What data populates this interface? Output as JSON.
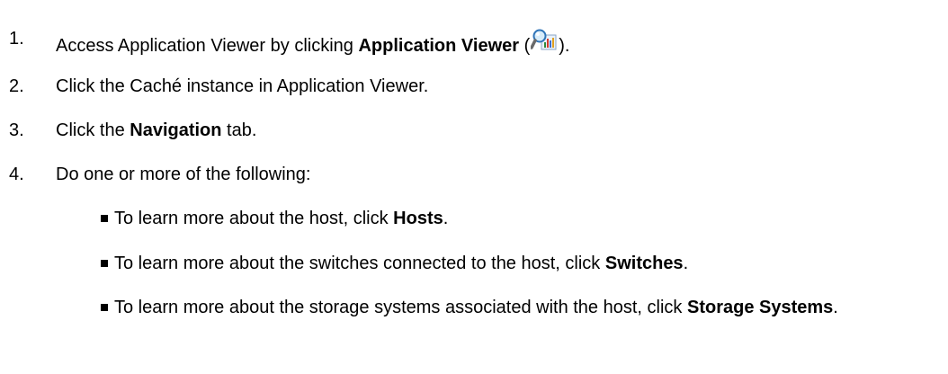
{
  "steps": [
    {
      "number": "1.",
      "pre": "Access Application Viewer by clicking ",
      "bold": "Application Viewer",
      "open_paren": " (",
      "icon": "application-viewer-icon",
      "close_paren": ")."
    },
    {
      "number": "2.",
      "text": "Click the Caché instance in Application Viewer."
    },
    {
      "number": "3.",
      "pre": "Click the ",
      "bold": "Navigation",
      "post": " tab."
    },
    {
      "number": "4.",
      "text": "Do one or more of the following:"
    }
  ],
  "substeps": [
    {
      "pre": "To learn more about the host, click ",
      "bold": "Hosts",
      "post": "."
    },
    {
      "pre": "To learn more about the switches connected to the host, click ",
      "bold": "Switches",
      "post": "."
    },
    {
      "pre": "To learn more about the storage systems associated with the host, click ",
      "bold": "Storage Systems",
      "post": "."
    }
  ]
}
